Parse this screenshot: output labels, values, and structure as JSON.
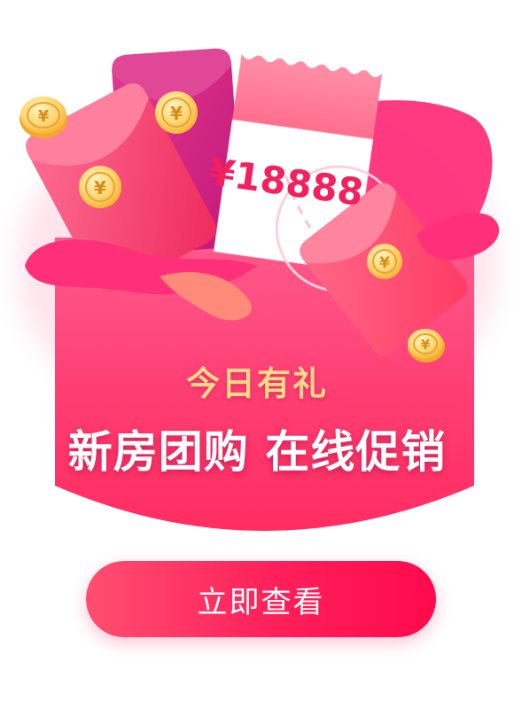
{
  "ticket": {
    "amount": "¥18888"
  },
  "coin_symbol": "¥",
  "headline": {
    "subtitle": "今日有礼",
    "title": "新房团购 在线促销"
  },
  "cta": {
    "label": "立即查看"
  },
  "colors": {
    "envelope_pink": "#ff3d72",
    "accent_gold": "#ffd98a",
    "button_start": "#ff4e70",
    "button_end": "#ff0a4c"
  }
}
